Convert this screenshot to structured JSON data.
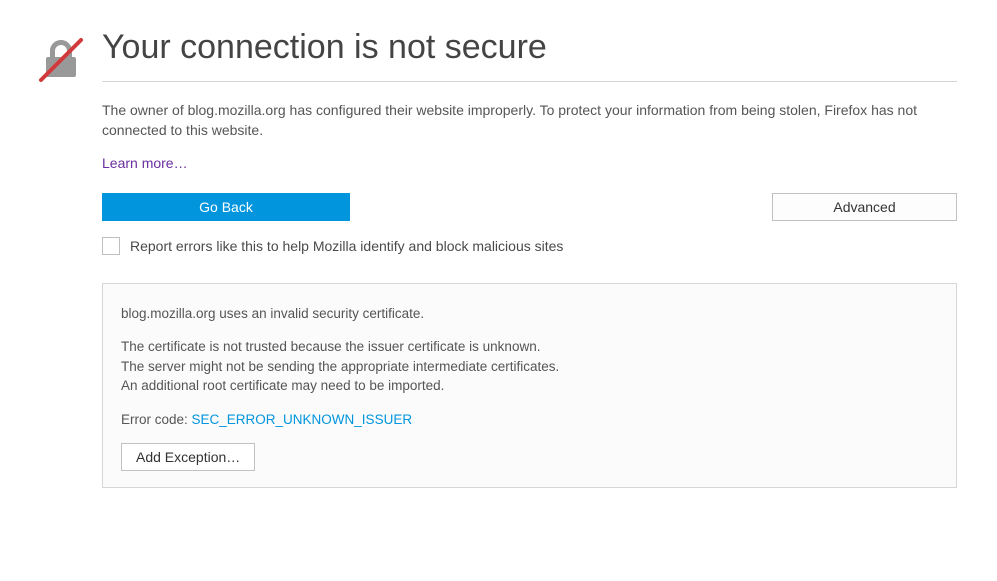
{
  "title": "Your connection is not secure",
  "description": "The owner of blog.mozilla.org has configured their website improperly. To protect your information from being stolen, Firefox has not connected to this website.",
  "learn_more": "Learn more…",
  "buttons": {
    "go_back": "Go Back",
    "advanced": "Advanced"
  },
  "report_checkbox_label": "Report errors like this to help Mozilla identify and block malicious sites",
  "details": {
    "line1": "blog.mozilla.org uses an invalid security certificate.",
    "line2": "The certificate is not trusted because the issuer certificate is unknown.",
    "line3": "The server might not be sending the appropriate intermediate certificates.",
    "line4": "An additional root certificate may need to be imported.",
    "error_code_prefix": "Error code: ",
    "error_code": "SEC_ERROR_UNKNOWN_ISSUER",
    "add_exception": "Add Exception…"
  }
}
